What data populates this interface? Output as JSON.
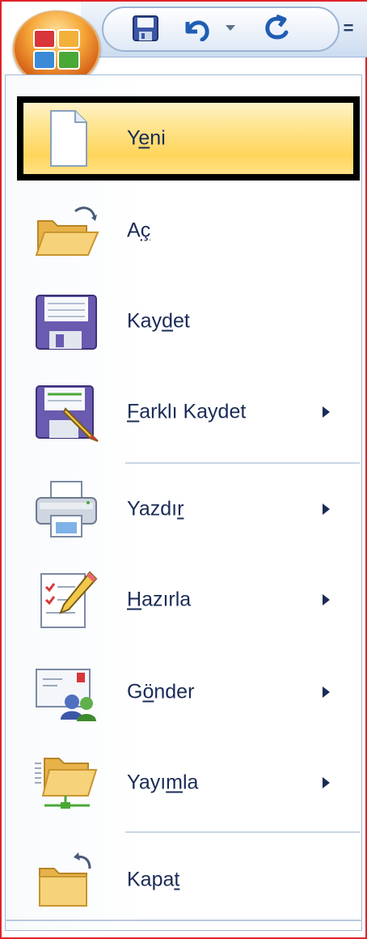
{
  "quick_access_toolbar": {
    "icons": [
      "office-button-icon",
      "save-icon",
      "undo-icon",
      "undo-dropdown-icon",
      "redo-icon",
      "customize-icon"
    ],
    "customize_glyph": "="
  },
  "menu": {
    "items": [
      {
        "pre": "Y",
        "accel": "e",
        "post": "ni",
        "submenu": false,
        "icon": "new-document-icon"
      },
      {
        "pre": "A",
        "accel": "ç",
        "post": "",
        "submenu": false,
        "icon": "open-folder-icon"
      },
      {
        "pre": "Kay",
        "accel": "d",
        "post": "et",
        "submenu": false,
        "icon": "save-disk-icon"
      },
      {
        "pre": "",
        "accel": "F",
        "post": "arklı Kaydet",
        "submenu": true,
        "icon": "save-as-icon"
      },
      {
        "pre": "Yazdı",
        "accel": "r",
        "post": "",
        "submenu": true,
        "icon": "printer-icon"
      },
      {
        "pre": "",
        "accel": "H",
        "post": "azırla",
        "submenu": true,
        "icon": "prepare-icon"
      },
      {
        "pre": "G",
        "accel": "ö",
        "post": "nder",
        "submenu": true,
        "icon": "send-icon"
      },
      {
        "pre": "Yayı",
        "accel": "m",
        "post": "la",
        "submenu": true,
        "icon": "publish-icon"
      },
      {
        "pre": "Kapa",
        "accel": "t",
        "post": "",
        "submenu": false,
        "icon": "close-folder-icon"
      }
    ]
  },
  "colors": {
    "accent": "#ffd55a",
    "selection_outline": "#000000",
    "label": "#1a2b56",
    "frame": "#e0242b"
  }
}
